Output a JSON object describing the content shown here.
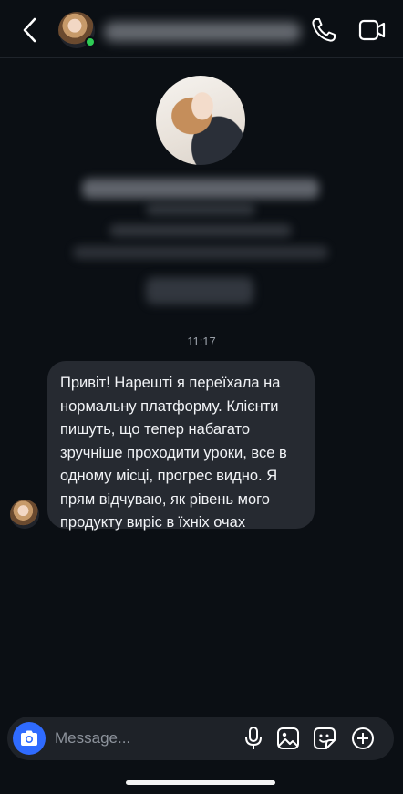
{
  "header": {
    "back_icon": "chevron-left-icon",
    "call_icon": "phone-icon",
    "video_icon": "video-camera-icon",
    "status_color": "#2ecc55"
  },
  "conversation": {
    "timestamp": "11:17",
    "message": "Привіт! Нарешті я переїхала на нормальну платформу. Клієнти пишуть, що тепер набагато зручніше проходити уроки, все в одному місці, прогрес видно. Я прям відчуваю, як рівень мого продукту виріс в їхніх очах"
  },
  "composer": {
    "placeholder": "Message...",
    "accent_color": "#2f6bff",
    "icons": [
      "camera-icon",
      "microphone-icon",
      "image-icon",
      "sticker-icon",
      "plus-icon"
    ]
  }
}
